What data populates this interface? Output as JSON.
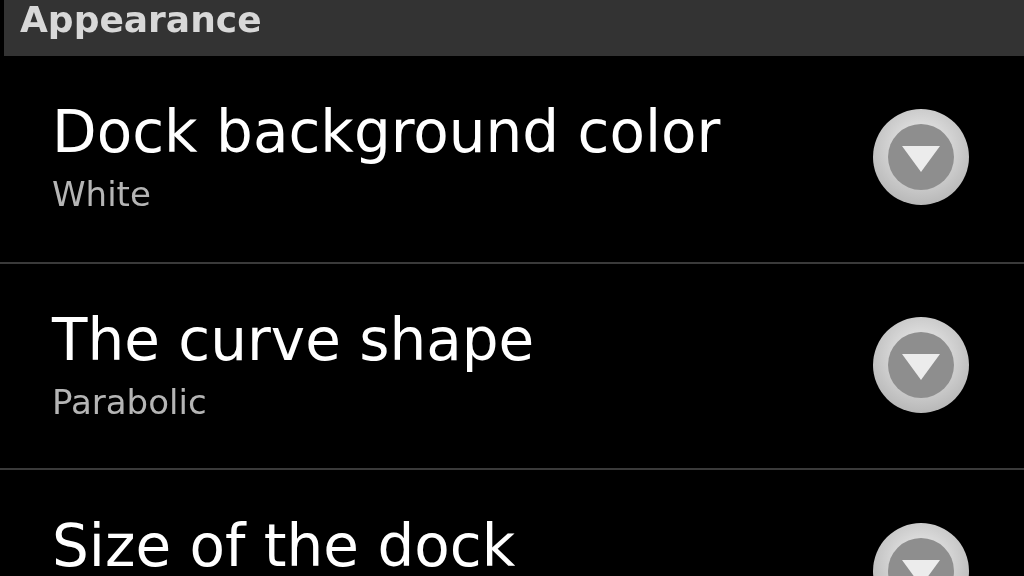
{
  "section": {
    "title": "Appearance"
  },
  "items": [
    {
      "kind": "list",
      "title": "Dock background color",
      "summary": "White"
    },
    {
      "kind": "list",
      "title": "The curve shape",
      "summary": "Parabolic"
    },
    {
      "kind": "list",
      "title": "Size of the dock"
    }
  ]
}
